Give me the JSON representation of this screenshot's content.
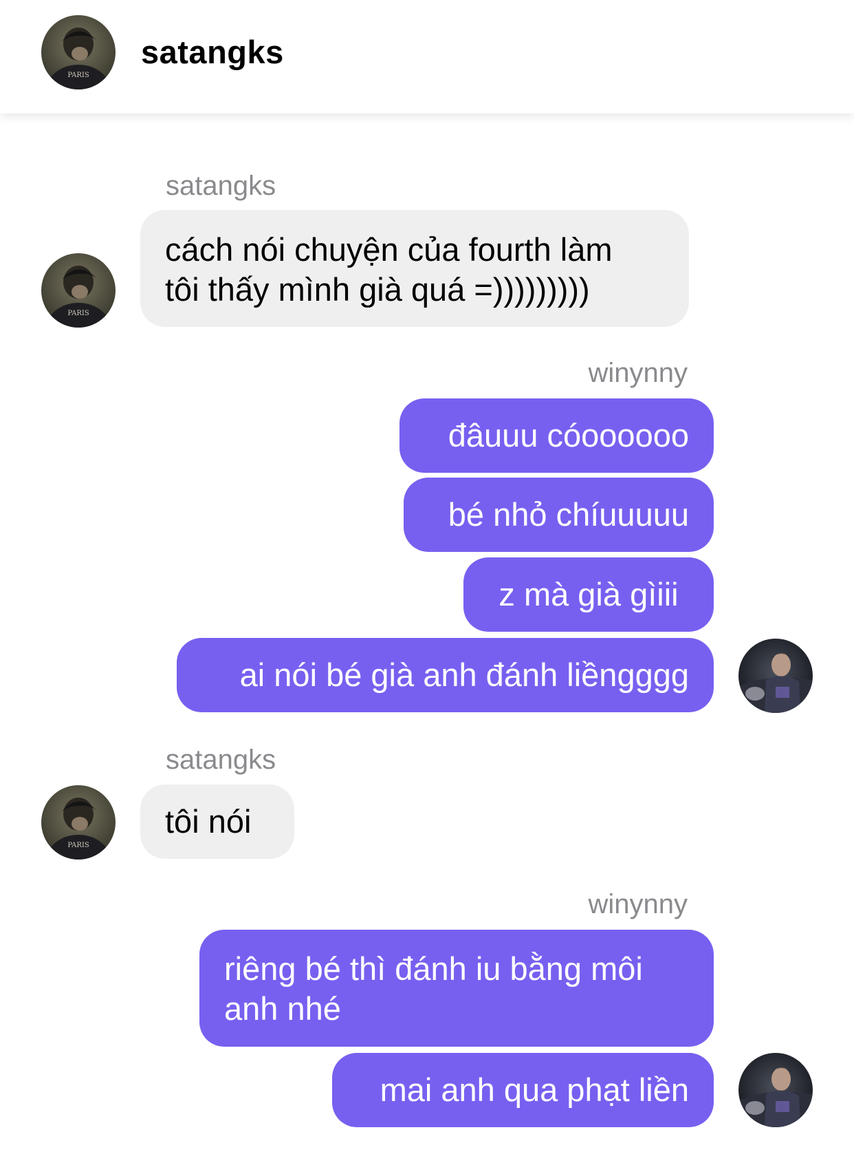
{
  "header": {
    "title": "satangks"
  },
  "messages": [
    {
      "sender": "satangks",
      "lines": [
        "cách nói chuyện của fourth làm",
        "tôi thấy mình già quá =)))))))))"
      ]
    },
    {
      "sender": "winynny",
      "bubbles": [
        "đâuuu cóoooooo",
        "bé nhỏ chíuuuuu",
        "z mà già gìiii",
        "ai nói bé già anh đánh liềngggg"
      ]
    },
    {
      "sender": "satangks",
      "lines": [
        "tôi nói"
      ]
    },
    {
      "sender": "winynny",
      "bubbles": [
        [
          "riêng bé thì đánh iu bằng môi",
          "anh nhé"
        ],
        "mai anh qua phạt liền"
      ]
    }
  ],
  "colors": {
    "outgoing_bubble": "#7760f0",
    "incoming_bubble": "#efefef",
    "sender_label": "#8a8a8e"
  }
}
